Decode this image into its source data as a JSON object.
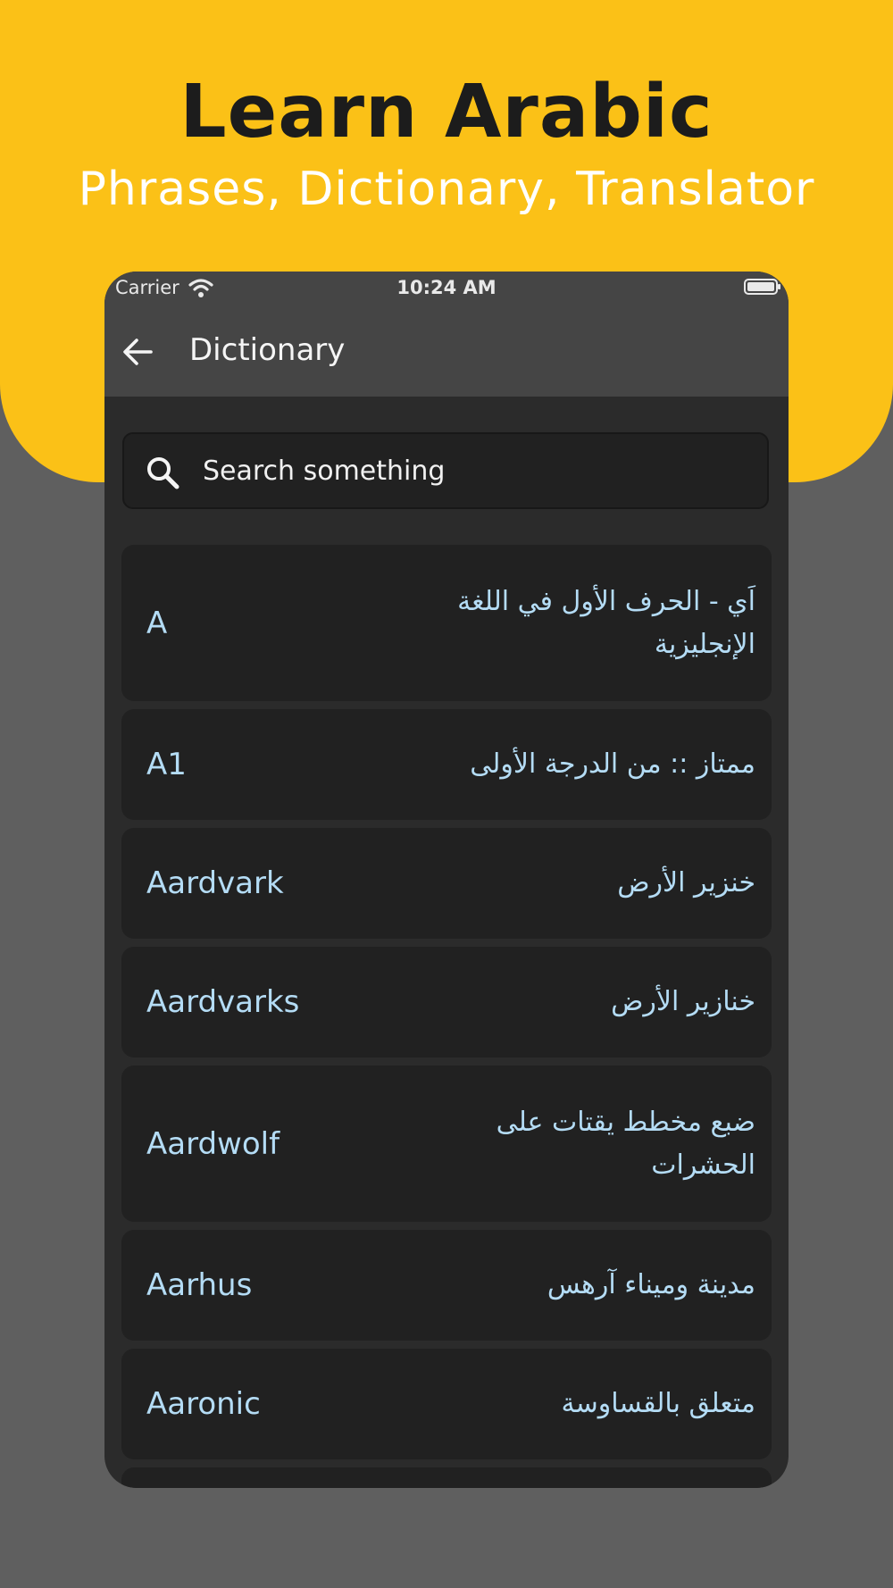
{
  "hero": {
    "title": "Learn Arabic",
    "subtitle": "Phrases, Dictionary, Translator"
  },
  "status_bar": {
    "carrier": "Carrier",
    "time": "10:24 AM"
  },
  "app_bar": {
    "title": "Dictionary",
    "back_icon": "arrow-left-icon"
  },
  "search": {
    "placeholder": "Search something",
    "icon": "search-icon"
  },
  "entries": [
    {
      "en": "A",
      "ar": "اَي - الحرف الأول في اللغة الإنجليزية"
    },
    {
      "en": "A1",
      "ar": "ممتاز :: من الدرجة الأولى"
    },
    {
      "en": "Aardvark",
      "ar": "خنزير الأرض"
    },
    {
      "en": "Aardvarks",
      "ar": "خنازير الأرض"
    },
    {
      "en": "Aardwolf",
      "ar": "ضبع مخطط يقتات على الحشرات"
    },
    {
      "en": "Aarhus",
      "ar": "مدينة وميناء آرهس"
    },
    {
      "en": "Aaronic",
      "ar": "متعلق بالقساوسة"
    }
  ],
  "colors": {
    "hero_background": "#fbc117",
    "page_background": "#5f5f5f",
    "app_bar": "#454545",
    "list_background": "#2b2b2b",
    "row_background": "#212121",
    "entry_text": "#b4dcf5"
  }
}
